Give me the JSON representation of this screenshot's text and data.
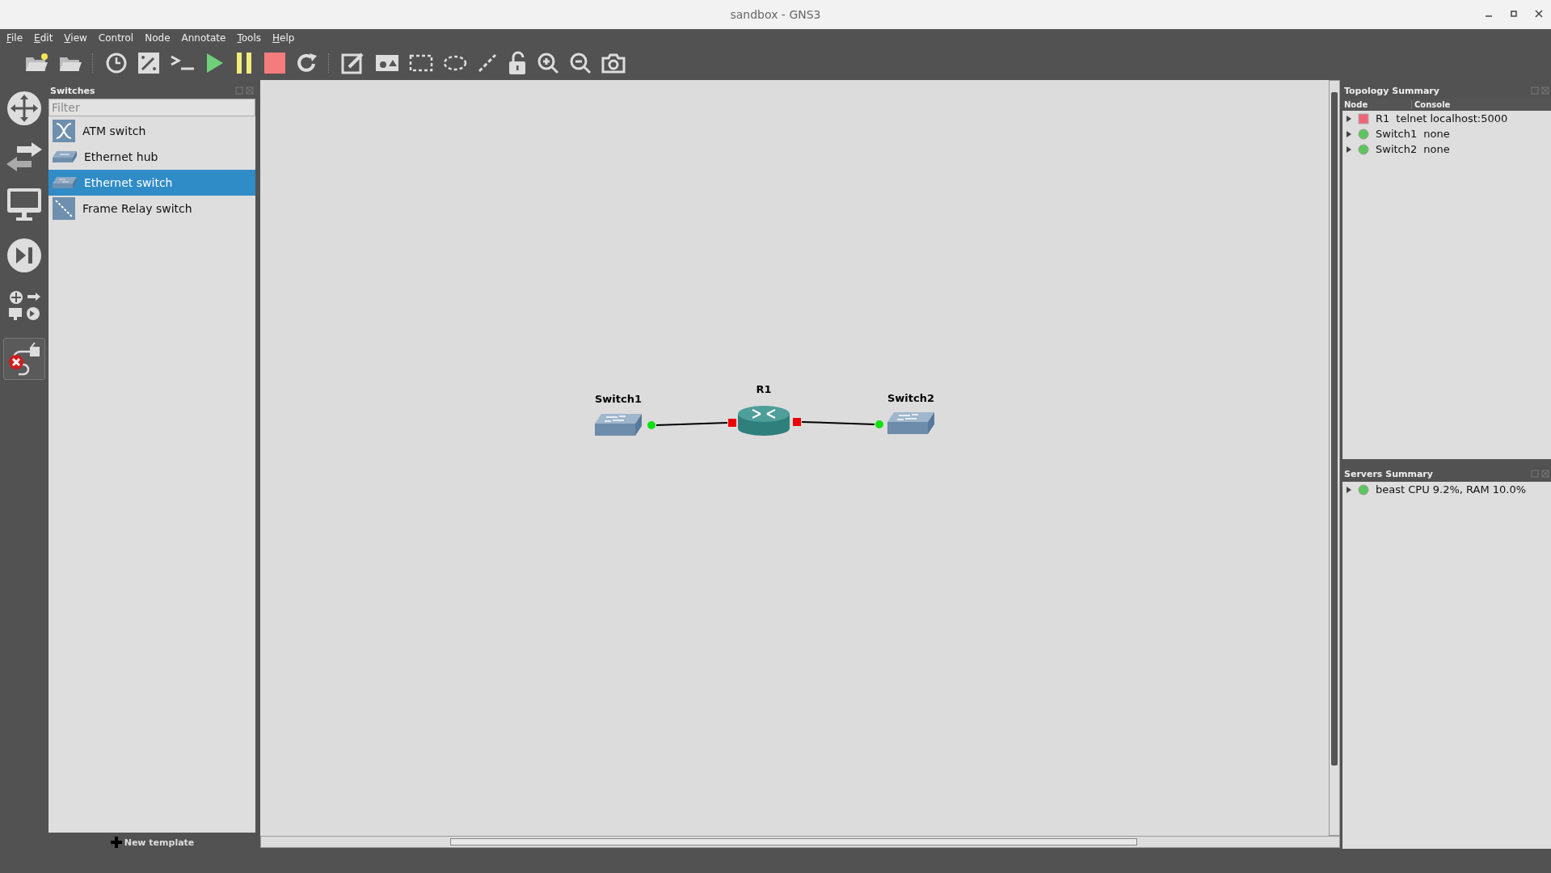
{
  "window": {
    "title": "sandbox - GNS3"
  },
  "menu": [
    {
      "label": "File",
      "mnemonic": true
    },
    {
      "label": "Edit",
      "mnemonic": true
    },
    {
      "label": "View",
      "mnemonic": true
    },
    {
      "label": "Control",
      "mnemonic": false
    },
    {
      "label": "Node",
      "mnemonic": false
    },
    {
      "label": "Annotate",
      "mnemonic": false
    },
    {
      "label": "Tools",
      "mnemonic": true
    },
    {
      "label": "Help",
      "mnemonic": true
    }
  ],
  "palette": {
    "add_link_on": true
  },
  "switches_dock": {
    "title": "Switches",
    "filter": {
      "placeholder": "Filter"
    },
    "items": [
      {
        "label": "ATM switch",
        "kind": "atm",
        "selected": false
      },
      {
        "label": "Ethernet hub",
        "kind": "hub",
        "selected": false
      },
      {
        "label": "Ethernet switch",
        "kind": "switch",
        "selected": true
      },
      {
        "label": "Frame Relay switch",
        "kind": "frame",
        "selected": false
      }
    ],
    "new_template": "New template"
  },
  "canvas": {
    "nodes": [
      {
        "label": "Switch1",
        "kind": "switch"
      },
      {
        "label": "R1",
        "kind": "router"
      },
      {
        "label": "Switch2",
        "kind": "switch"
      }
    ],
    "links": [
      {
        "from_up": true,
        "to_up": false
      },
      {
        "from_up": false,
        "to_up": true
      }
    ]
  },
  "topology_summary": {
    "title": "Topology Summary",
    "columns": [
      "Node",
      "Console"
    ],
    "rows": [
      {
        "node": "R1",
        "console": "telnet localhost:5000",
        "started": false
      },
      {
        "node": "Switch1",
        "console": "none",
        "started": true
      },
      {
        "node": "Switch2",
        "console": "none",
        "started": true
      }
    ]
  },
  "servers_summary": {
    "title": "Servers Summary",
    "rows": [
      {
        "label": "beast CPU 9.2%, RAM 10.0%",
        "started": true
      }
    ]
  }
}
